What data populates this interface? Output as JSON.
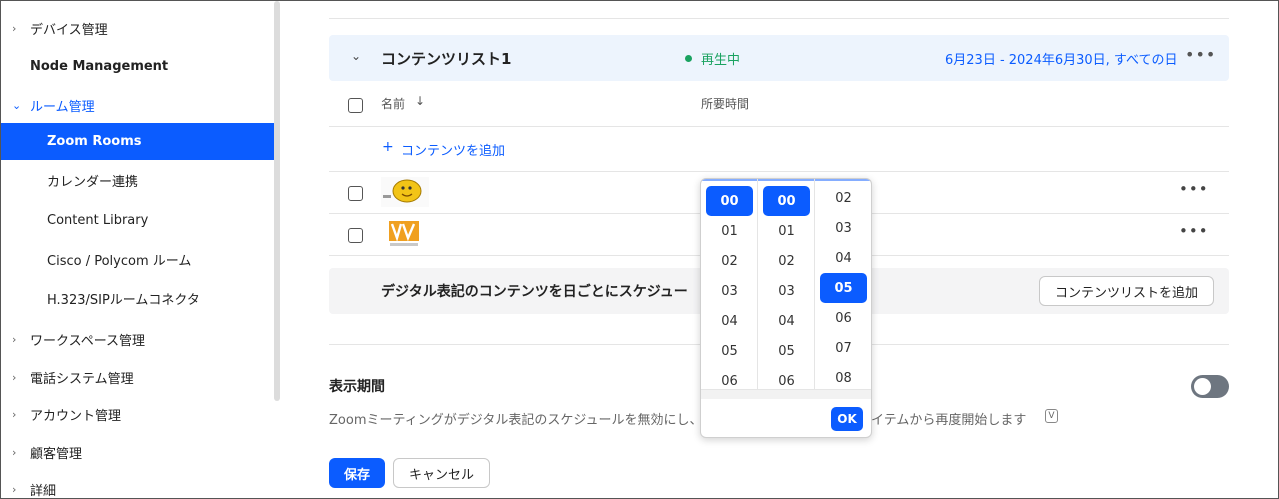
{
  "sidebar": {
    "items": [
      {
        "label": "デバイス管理",
        "chevron": "›"
      },
      {
        "label": "Node Management"
      },
      {
        "label": "ルーム管理",
        "chevron": "⌄"
      },
      {
        "label": "Zoom Rooms"
      },
      {
        "label": "カレンダー連携"
      },
      {
        "label": "Content Library"
      },
      {
        "label": "Cisco / Polycom ルーム"
      },
      {
        "label": "H.323/SIPルームコネクタ"
      },
      {
        "label": "ワークスペース管理",
        "chevron": "›"
      },
      {
        "label": "電話システム管理",
        "chevron": "›"
      },
      {
        "label": "アカウント管理",
        "chevron": "›"
      },
      {
        "label": "顧客管理",
        "chevron": "›"
      },
      {
        "label": "詳細",
        "chevron": "›"
      }
    ]
  },
  "content_list": {
    "title": "コンテンツリスト1",
    "status": "再生中",
    "dates": "6月23日 - 2024年6月30日, すべての日",
    "more": "•••",
    "col_name": "名前",
    "sort_arrow": "↓",
    "col_duration": "所要時間",
    "add_plus": "+",
    "add_content": "コンテンツを追加",
    "row_more": "•••"
  },
  "schedule": {
    "text": "デジタル表記のコンテンツを日ごとにスケジュー",
    "add_list_button": "コンテンツリストを追加"
  },
  "period": {
    "title": "表示期間",
    "desc_left": "Zoomミーティングがデジタル表記のスケジュールを無効にし、",
    "desc_right": "イテムから再度開始します",
    "v_icon": "V"
  },
  "footer": {
    "save": "保存",
    "cancel": "キャンセル"
  },
  "picker": {
    "hours": [
      "00",
      "01",
      "02",
      "03",
      "04",
      "05",
      "06"
    ],
    "minutes": [
      "00",
      "01",
      "02",
      "03",
      "04",
      "05",
      "06"
    ],
    "seconds": [
      "02",
      "03",
      "04",
      "05",
      "06",
      "07",
      "08"
    ],
    "selected_hour": "00",
    "selected_minute": "00",
    "selected_second": "05",
    "ok": "OK"
  },
  "colors": {
    "accent": "#0b5cff",
    "status_green": "#1aa260"
  }
}
